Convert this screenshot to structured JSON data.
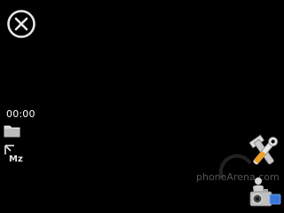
{
  "viewfinder": {
    "mode": "video-recording",
    "timer": "00:00"
  },
  "icons": {
    "close": "close-circle-icon",
    "storage": "folder-icon",
    "resolution": "resolution-mz-icon",
    "resolution_label": "Mz",
    "settings": "wrench-icon",
    "camera_mode": "video-camera-icon"
  },
  "watermark": {
    "text": "phoneArena.com"
  },
  "colors": {
    "background": "#000000",
    "icon": "#e6e6e6",
    "accent_orange": "#f0a020",
    "accent_blue": "#3a78d8"
  }
}
